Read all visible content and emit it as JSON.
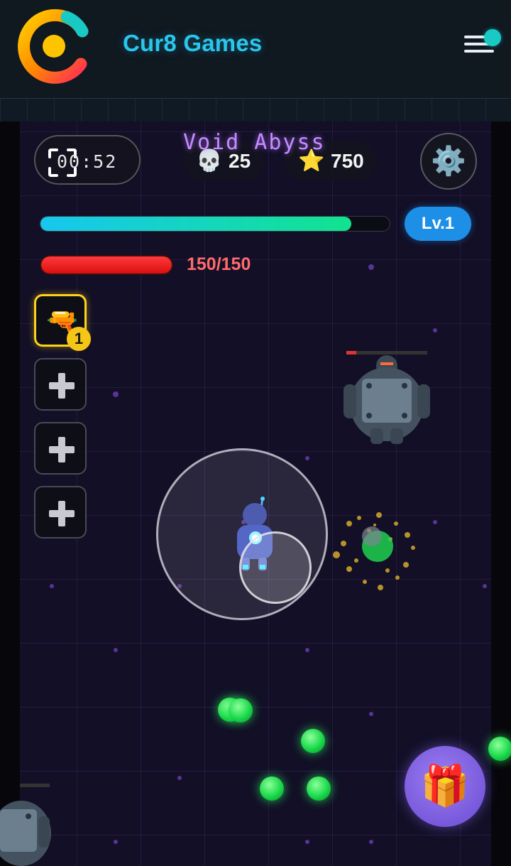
{
  "header": {
    "brand": "Cur8 Games",
    "logo_icon": "cur8-logo",
    "menu_icon": "hamburger-menu-icon",
    "notification_color": "#19c9c4"
  },
  "hud": {
    "title": "Void Abyss",
    "timer": "00:52",
    "kills": "25",
    "score": "750",
    "level_label": "Lv.1",
    "xp_progress": 0.89,
    "hp_text": "150/150",
    "hp_progress": 1.0
  },
  "weapons": {
    "active_slot": {
      "icon": "water-pistol-icon",
      "emoji": "🔫",
      "count": "1"
    },
    "empty_slots": 3
  },
  "icons": {
    "kills": "💀",
    "score": "⭐",
    "settings": "⚙️",
    "gift": "🎁"
  },
  "colors": {
    "xp_start": "#17c7ef",
    "xp_end": "#11e38f",
    "hp": "#e81a1a",
    "level_badge": "#1d8fe6",
    "active_slot_border": "#ffd21a",
    "title_glow": "#c58cff"
  }
}
